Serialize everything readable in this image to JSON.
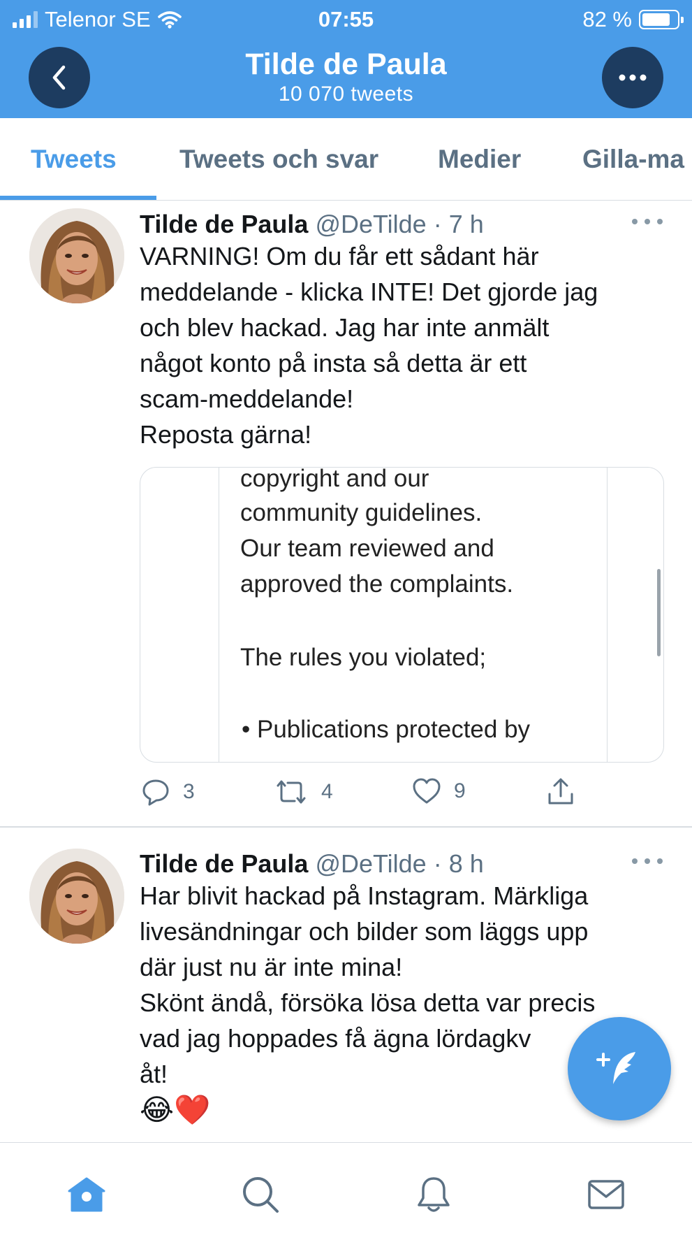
{
  "status_bar": {
    "carrier": "Telenor SE",
    "time": "07:55",
    "battery": "82 %",
    "battery_level": 0.82
  },
  "header": {
    "title": "Tilde de Paula",
    "subtitle": "10 070 tweets",
    "back_icon": "chevron-left-icon",
    "more_icon": "more-icon"
  },
  "tabs": [
    {
      "label": "Tweets",
      "active": true
    },
    {
      "label": "Tweets och svar",
      "active": false
    },
    {
      "label": "Medier",
      "active": false
    },
    {
      "label": "Gilla-ma",
      "active": false
    }
  ],
  "tweets": [
    {
      "name": "Tilde de Paula",
      "meta": "@DeTilde · 7 h",
      "text": "VARNING! Om du får ett sådant här\nmeddelande - klicka INTE! Det gjorde jag\noch blev hackad. Jag har inte anmält\nnågot konto på insta så detta är ett\nscam-meddelande!\nReposta gärna!",
      "media_lines": [
        "copyright and our",
        "community guidelines.",
        "Our team reviewed and",
        "approved the complaints.",
        "The rules you violated;",
        "• Publications protected by"
      ],
      "reply_count": "3",
      "retweet_count": "4",
      "like_count": "9"
    },
    {
      "name": "Tilde de Paula",
      "meta": "@DeTilde · 8 h",
      "text": "Har blivit hackad på Instagram. Märkliga\nlivesändningar och bilder som läggs upp\ndär just nu är inte mina!\nSkönt ändå, försöka lösa detta var precis\nvad jag hoppades få ägna  lördagkv\nåt!",
      "emoji": "😂❤️"
    }
  ],
  "colors": {
    "accent": "#4a9ce8",
    "header_button": "#1d3c60",
    "muted": "#5b7083"
  }
}
